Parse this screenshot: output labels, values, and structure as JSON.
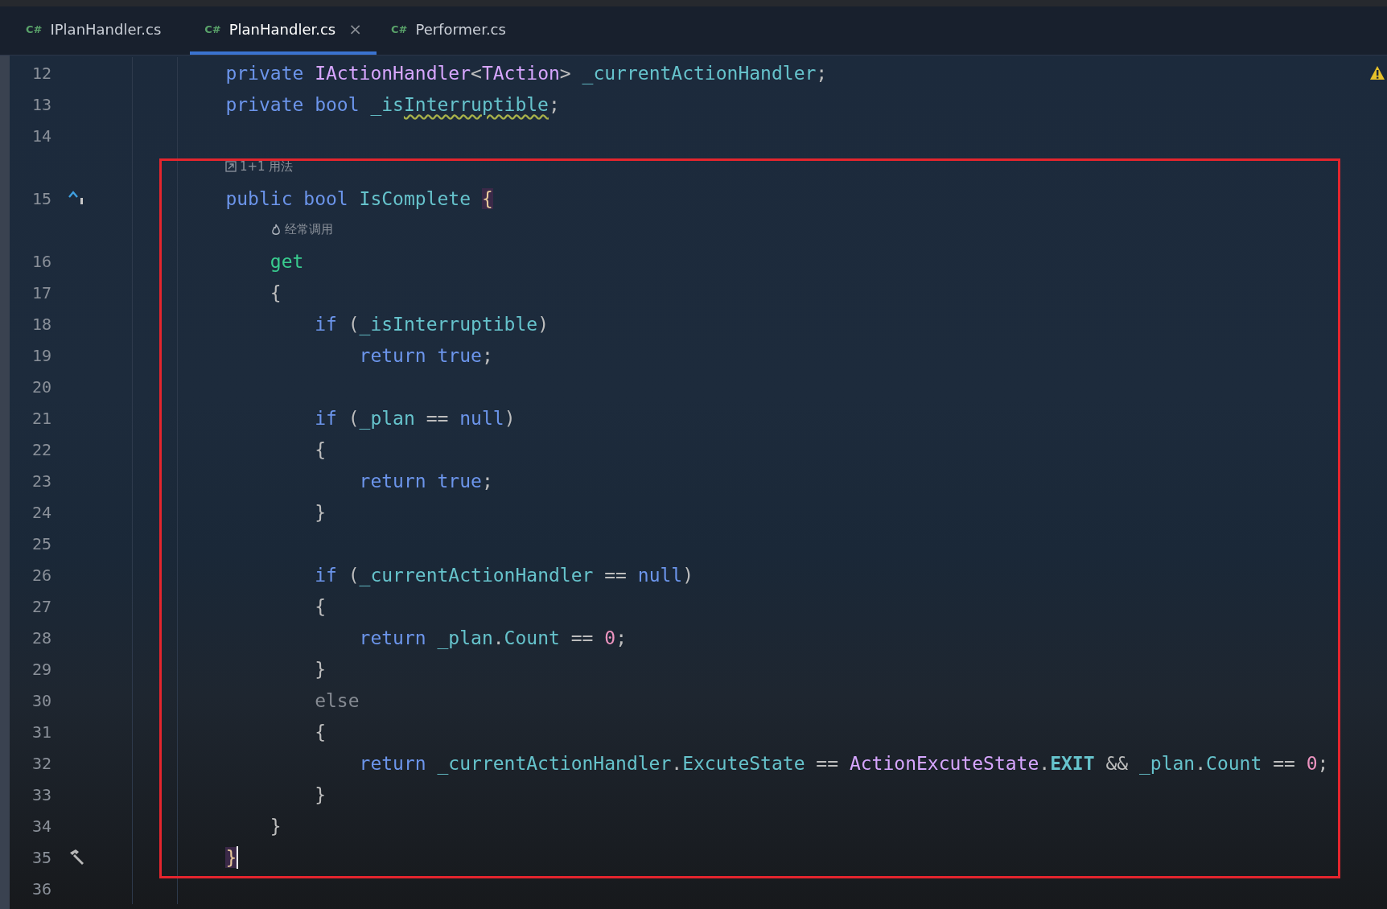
{
  "tabs": [
    {
      "icon_text": "C#",
      "label": "IPlanHandler.cs",
      "selected": false
    },
    {
      "icon_text": "C#",
      "label": "PlanHandler.cs",
      "selected": true,
      "close": "×"
    },
    {
      "icon_text": "C#",
      "label": "Performer.cs",
      "selected": false
    }
  ],
  "editor": {
    "warning": true,
    "highlight_box": true,
    "lines": [
      {
        "kind": "code",
        "number": "12",
        "tokens": [
          {
            "text": "    private ",
            "color": "#6c95eb"
          },
          {
            "text": "IActionHandler",
            "color": "#d7a6ff"
          },
          {
            "text": "<",
            "color": "#bdbdbd"
          },
          {
            "text": "TAction",
            "color": "#d7a6ff"
          },
          {
            "text": "> ",
            "color": "#bdbdbd"
          },
          {
            "text": "_currentActionHandler",
            "color": "#66c3cc"
          },
          {
            "text": ";",
            "color": "#bdbdbd"
          }
        ]
      },
      {
        "kind": "code",
        "number": "13",
        "tokens": [
          {
            "text": "    private bool ",
            "color": "#6c95eb"
          },
          {
            "text": "_is",
            "color": "#66c3cc"
          },
          {
            "text": "Interruptible",
            "color": "#66c3cc",
            "warning": true
          },
          {
            "text": ";",
            "color": "#bdbdbd"
          }
        ]
      },
      {
        "kind": "code",
        "number": "14"
      },
      {
        "kind": "usages_hint",
        "text": "1+1 用法"
      },
      {
        "kind": "override_code",
        "number": "15",
        "tokens": [
          {
            "text": "    public bool ",
            "color": "#6c95eb"
          },
          {
            "text": "IsComplete ",
            "color": "#66c3cc"
          },
          {
            "text": "{",
            "highlighted": true
          }
        ]
      },
      {
        "kind": "frequent_hint",
        "text": "经常调用"
      },
      {
        "kind": "code",
        "number": "16",
        "tokens": [
          {
            "text": "        get",
            "color": "#39cc8f"
          }
        ]
      },
      {
        "kind": "code",
        "number": "17",
        "tokens": [
          {
            "text": "        {",
            "color": "#bdbdbd"
          }
        ]
      },
      {
        "kind": "code",
        "number": "18",
        "tokens": [
          {
            "text": "            if ",
            "color": "#6c95eb"
          },
          {
            "text": "(",
            "color": "#bdbdbd"
          },
          {
            "text": "_isInterruptible",
            "color": "#66c3cc"
          },
          {
            "text": ")",
            "color": "#bdbdbd"
          }
        ]
      },
      {
        "kind": "code",
        "number": "19",
        "tokens": [
          {
            "text": "                return true",
            "color": "#6c95eb"
          },
          {
            "text": ";",
            "color": "#bdbdbd"
          }
        ]
      },
      {
        "kind": "code",
        "number": "20"
      },
      {
        "kind": "code",
        "number": "21",
        "tokens": [
          {
            "text": "            if ",
            "color": "#6c95eb"
          },
          {
            "text": "(",
            "color": "#bdbdbd"
          },
          {
            "text": "_plan",
            "color": "#66c3cc"
          },
          {
            "text": " == ",
            "color": "#bdbdbd"
          },
          {
            "text": "null",
            "color": "#6c95eb"
          },
          {
            "text": ")",
            "color": "#bdbdbd"
          }
        ]
      },
      {
        "kind": "code",
        "number": "22",
        "tokens": [
          {
            "text": "            {",
            "color": "#bdbdbd"
          }
        ]
      },
      {
        "kind": "code",
        "number": "23",
        "tokens": [
          {
            "text": "                return true",
            "color": "#6c95eb"
          },
          {
            "text": ";",
            "color": "#bdbdbd"
          }
        ]
      },
      {
        "kind": "code",
        "number": "24",
        "tokens": [
          {
            "text": "            }",
            "color": "#bdbdbd"
          }
        ]
      },
      {
        "kind": "code",
        "number": "25"
      },
      {
        "kind": "code",
        "number": "26",
        "tokens": [
          {
            "text": "            if ",
            "color": "#6c95eb"
          },
          {
            "text": "(",
            "color": "#bdbdbd"
          },
          {
            "text": "_currentActionHandler",
            "color": "#66c3cc"
          },
          {
            "text": " == ",
            "color": "#bdbdbd"
          },
          {
            "text": "null",
            "color": "#6c95eb"
          },
          {
            "text": ")",
            "color": "#bdbdbd"
          }
        ]
      },
      {
        "kind": "code",
        "number": "27",
        "tokens": [
          {
            "text": "            {",
            "color": "#bdbdbd"
          }
        ]
      },
      {
        "kind": "code",
        "number": "28",
        "tokens": [
          {
            "text": "                return ",
            "color": "#6c95eb"
          },
          {
            "text": "_plan",
            "color": "#66c3cc"
          },
          {
            "text": ".",
            "color": "#bdbdbd"
          },
          {
            "text": "Count",
            "color": "#66c3cc"
          },
          {
            "text": " == ",
            "color": "#bdbdbd"
          },
          {
            "text": "0",
            "color": "#ed94c0"
          },
          {
            "text": ";",
            "color": "#bdbdbd"
          }
        ]
      },
      {
        "kind": "code",
        "number": "29",
        "tokens": [
          {
            "text": "            }",
            "color": "#bdbdbd"
          }
        ]
      },
      {
        "kind": "code",
        "number": "30",
        "tokens": [
          {
            "text": "            else",
            "color": "#858a92"
          }
        ]
      },
      {
        "kind": "code",
        "number": "31",
        "tokens": [
          {
            "text": "            {",
            "color": "#bdbdbd"
          }
        ]
      },
      {
        "kind": "code",
        "number": "32",
        "tokens": [
          {
            "text": "                return ",
            "color": "#6c95eb"
          },
          {
            "text": "_currentActionHandler",
            "color": "#66c3cc"
          },
          {
            "text": ".",
            "color": "#bdbdbd"
          },
          {
            "text": "ExcuteState",
            "color": "#66c3cc"
          },
          {
            "text": " == ",
            "color": "#bdbdbd"
          },
          {
            "text": "ActionExcuteState",
            "color": "#d7a6ff"
          },
          {
            "text": ".",
            "color": "#bdbdbd"
          },
          {
            "text": "EXIT",
            "color": "#66c3cc",
            "bold": true
          },
          {
            "text": " && ",
            "color": "#bdbdbd"
          },
          {
            "text": "_plan",
            "color": "#66c3cc"
          },
          {
            "text": ".",
            "color": "#bdbdbd"
          },
          {
            "text": "Count",
            "color": "#66c3cc"
          },
          {
            "text": " == ",
            "color": "#bdbdbd"
          },
          {
            "text": "0",
            "color": "#ed94c0"
          },
          {
            "text": ";",
            "color": "#bdbdbd"
          }
        ]
      },
      {
        "kind": "code",
        "number": "33",
        "tokens": [
          {
            "text": "            }",
            "color": "#bdbdbd"
          }
        ]
      },
      {
        "kind": "code",
        "number": "34",
        "tokens": [
          {
            "text": "        }",
            "color": "#bdbdbd"
          }
        ]
      },
      {
        "kind": "hammer_code",
        "number": "35",
        "caret": true,
        "tokens": [
          {
            "text": "    }",
            "highlighted": true
          }
        ]
      },
      {
        "kind": "code",
        "number": "36"
      }
    ]
  }
}
